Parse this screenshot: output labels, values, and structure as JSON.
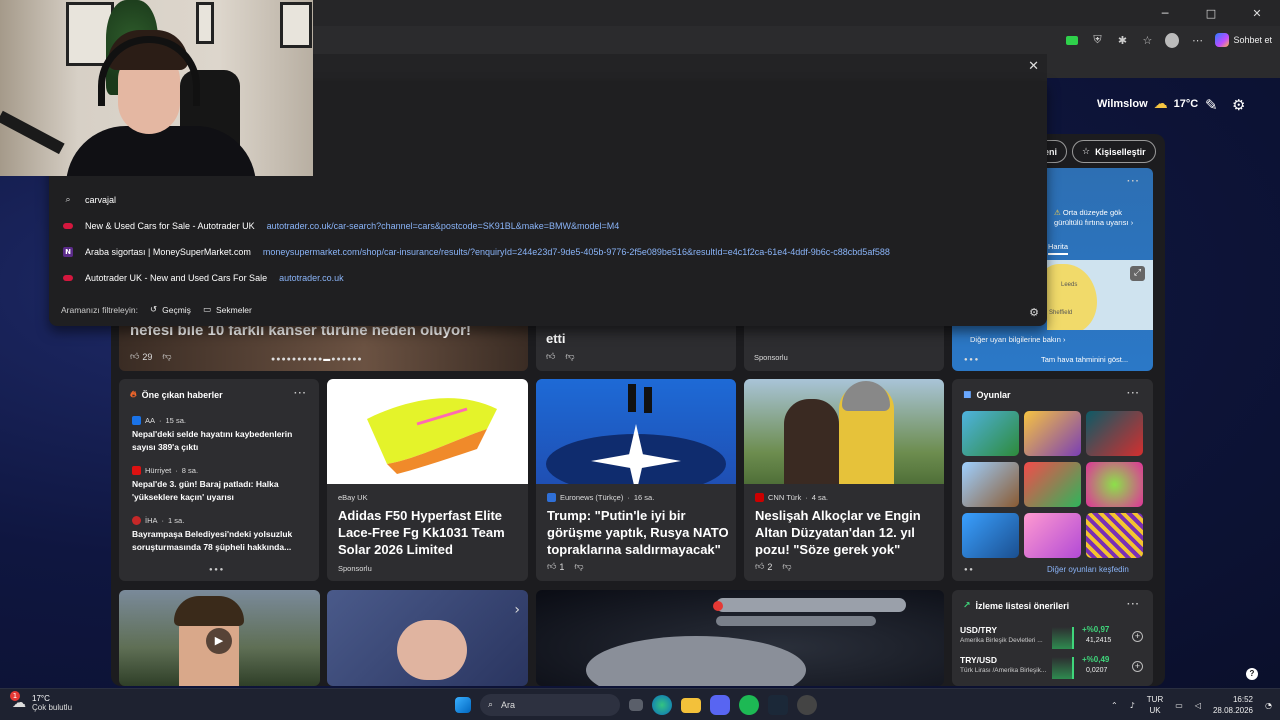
{
  "window": {
    "minimize": "─",
    "maximize": "□",
    "close": "✕"
  },
  "toolbar": {
    "chat_label": "Sohbet et"
  },
  "header": {
    "location": "Wilmslow",
    "temperature": "17°C"
  },
  "feed_controls": {
    "partial_label": "eni",
    "personalize": "Kişiselleştir"
  },
  "omnibox": {
    "partial_top": "carvajal",
    "suggestions": [
      {
        "type": "search",
        "text": "carvajal",
        "url": ""
      },
      {
        "type": "site",
        "text": "New & Used Cars for Sale - Autotrader UK",
        "url": "autotrader.co.uk/car-search?channel=cars&postcode=SK91BL&make=BMW&model=M4"
      },
      {
        "type": "site",
        "text": "Araba sigortası | MoneySuperMarket.com",
        "url": "moneysupermarket.com/shop/car-insurance/results/?enquiryId=244e23d7-9de5-405b-9776-2f5e089be516&resultId=e4c1f2ca-61e4-4ddf-9b6c-c88cbd5af588"
      },
      {
        "type": "site",
        "text": "Autotrader UK - New and Used Cars For Sale",
        "url": "autotrader.co.uk"
      }
    ],
    "filter_label": "Aramanızı filtreleyin:",
    "filter_history": "Geçmiş",
    "filter_tabs": "Sekmeler"
  },
  "top_row": {
    "card1_title": "nefesi bile 10 farklı kanser türüne neden oluyor!",
    "card1_likes": "29",
    "card2_title": "etti",
    "card3_sponsor": "Sponsorlu"
  },
  "weather_card": {
    "alert": "Orta düzeyde gök gürültülü fırtına uyarısı",
    "map_tab": "Harita",
    "more": "Diğer uyarı bilgilerine bakın",
    "detail_btn": "Tam hava tahminini göst...",
    "map_labels": [
      "Leeds",
      "Sheffield"
    ]
  },
  "top_news": {
    "title": "Öne çıkan haberler",
    "items": [
      {
        "source": "AA",
        "age": "15 sa.",
        "headline": "Nepal'deki selde hayatını kaybedenlerin sayısı 389'a çıktı",
        "color": "#1a73e8"
      },
      {
        "source": "Hürriyet",
        "age": "8 sa.",
        "headline": "Nepal'de 3. gün! Baraj patladı: Halka 'yükseklere kaçın' uyarısı",
        "color": "#d11"
      },
      {
        "source": "İHA",
        "age": "1 sa.",
        "headline": "Bayrampaşa Belediyesi'ndeki yolsuzluk soruşturmasında 78 şüpheli hakkında...",
        "color": "#c62828"
      }
    ]
  },
  "ebay_card": {
    "source": "eBay UK",
    "title": "Adidas F50 Hyperfast Elite Lace-Free Fg Kk1031 Team Solar 2026 Limited",
    "sponsor": "Sponsorlu"
  },
  "nato_card": {
    "source": "Euronews (Türkçe)",
    "age": "16 sa.",
    "title": "Trump: \"Putin'le iyi bir görüşme yaptık, Rusya NATO topraklarına saldırmayacak\"",
    "likes": "1"
  },
  "cnn_card": {
    "source": "CNN Türk",
    "age": "4 sa.",
    "title": "Neslişah Alkoçlar ve Engin Altan Düzyatan'dan 12. yıl pozu! \"Söze gerek yok\"",
    "likes": "2"
  },
  "games": {
    "title": "Oyunlar",
    "more": "Diğer oyunları keşfedin"
  },
  "watchlist": {
    "title": "İzleme listesi önerileri",
    "rows": [
      {
        "symbol": "USD/TRY",
        "name": "Amerika Birleşik Devletleri ...",
        "change": "+%0,97",
        "value": "41,2415"
      },
      {
        "symbol": "TRY/USD",
        "name": "Türk Lirası /Amerika Birleşik...",
        "change": "+%0,49",
        "value": "0,0207"
      }
    ]
  },
  "taskbar": {
    "temperature": "17°C",
    "condition": "Çok bulutlu",
    "search_placeholder": "Ara",
    "lang_top": "TUR",
    "lang_bottom": "UK",
    "time": "16:52",
    "date": "28.08.2026",
    "badge": "1"
  }
}
